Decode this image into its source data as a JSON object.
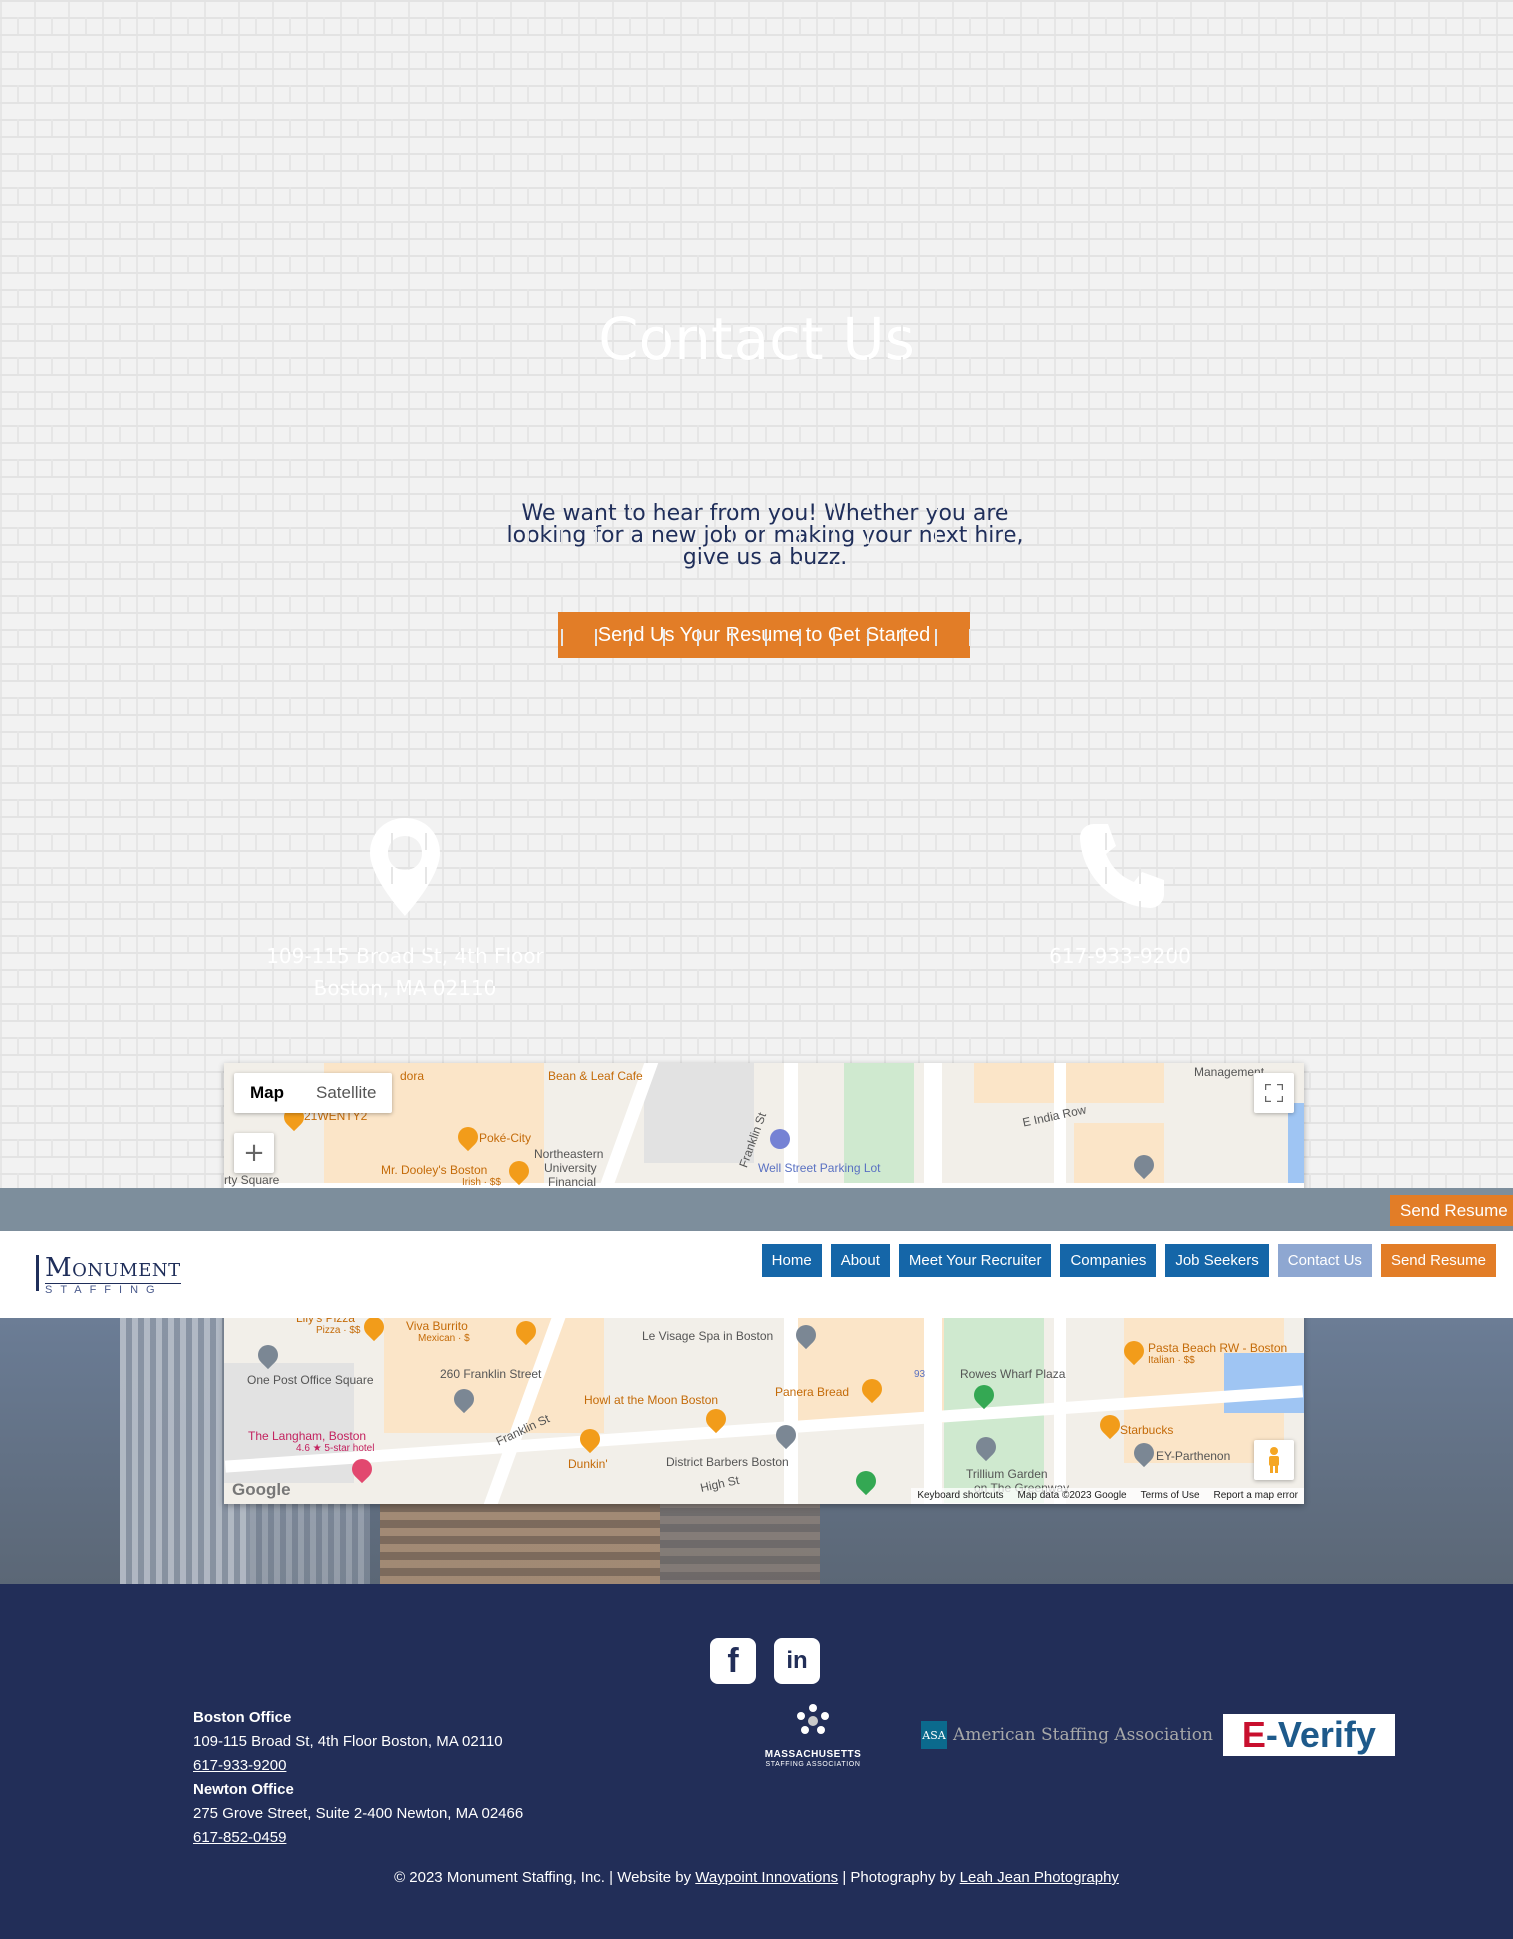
{
  "hero": {
    "title": "Contact Us",
    "intro": "We want to hear from you! Whether you are looking for a new job or making your next hire, give us a buzz.",
    "cta_label": "Send Us Your Resume to Get Started",
    "address_line1": "109-115 Broad St, 4th Floor",
    "address_line2": "Boston, MA 02110",
    "phone": "617-933-9200",
    "address_icon": "map-pin-icon",
    "phone_icon": "phone-icon"
  },
  "map": {
    "toggle_map": "Map",
    "toggle_satellite": "Satellite",
    "zoom_in": "+",
    "fullscreen_icon": "fullscreen-icon",
    "pegman_icon": "pegman-icon",
    "google": "Google",
    "labels": {
      "bean_leaf": "Bean & Leaf Cafe",
      "dora": "dora",
      "twenty2": "21WENTY2",
      "poke": "Poké-City",
      "mr_dooley": "Mr. Dooley's Boston",
      "mr_dooley_sub": "Irish · $$",
      "rty_square": "rty Square",
      "northeastern": "Northeastern",
      "university": "University",
      "financial": "Financial",
      "franklin_top": "Franklin St",
      "well_street": "Well Street Parking Lot",
      "e_india": "E India Row",
      "management": "Management",
      "lilys": "Lily's Pizza",
      "lilys_sub": "Pizza · $$",
      "viva": "Viva Burrito",
      "viva_sub": "Mexican · $",
      "visage": "Le Visage Spa in Boston",
      "pasta": "Pasta Beach RW - Boston",
      "pasta_sub": "Italian · $$",
      "one_post": "One Post Office Square",
      "franklin_260": "260 Franklin Street",
      "howl": "Howl at the Moon Boston",
      "panera": "Panera Bread",
      "rowes": "Rowes Wharf Plaza",
      "langham": "The Langham, Boston",
      "langham_sub": "4.6 ★ 5-star hotel",
      "franklin_bottom": "Franklin St",
      "dunkin": "Dunkin'",
      "district": "District Barbers Boston",
      "high_st": "High St",
      "starbucks": "Starbucks",
      "ey": "EY-Parthenon",
      "trillium": "Trillium Garden",
      "greenway": "on The Greenway",
      "i93": "93"
    },
    "footer": {
      "shortcuts": "Keyboard shortcuts",
      "data": "Map data ©2023 Google",
      "terms": "Terms of Use",
      "report": "Report a map error"
    }
  },
  "sticky": {
    "resume_label": "Send Resume"
  },
  "nav": {
    "logo_main": "Monument",
    "logo_sub": "STAFFING",
    "items": [
      {
        "label": "Home",
        "name": "nav-home"
      },
      {
        "label": "About",
        "name": "nav-about"
      },
      {
        "label": "Meet Your Recruiter",
        "name": "nav-meet-your-recruiter"
      },
      {
        "label": "Companies",
        "name": "nav-companies"
      },
      {
        "label": "Job Seekers",
        "name": "nav-job-seekers"
      },
      {
        "label": "Contact Us",
        "name": "nav-contact-us"
      },
      {
        "label": "Send Resume",
        "name": "nav-send-resume"
      }
    ]
  },
  "footer": {
    "facebook_icon": "facebook-icon",
    "linkedin_icon": "linkedin-icon",
    "facebook_glyph": "f",
    "linkedin_glyph": "in",
    "boston_heading": "Boston Office",
    "boston_address": "109-115 Broad St, 4th Floor Boston, MA 02110",
    "boston_phone": "617-933-9200",
    "newton_heading": "Newton Office",
    "newton_address": "275 Grove Street, Suite 2-400 Newton, MA 02466",
    "newton_phone": "617-852-0459",
    "mass_name": "MASSACHUSETTS",
    "mass_sub": "STAFFING ASSOCIATION",
    "asa_box": "ASA",
    "asa_text": "American Staffing Association",
    "everify_e": "E",
    "everify_rest": "-Verify",
    "copyright_pre": "© 2023 Monument Staffing, Inc. | Website by ",
    "waypoint": "Waypoint Innovations",
    "copyright_mid": " | Photography by ",
    "leah": "Leah Jean Photography"
  }
}
